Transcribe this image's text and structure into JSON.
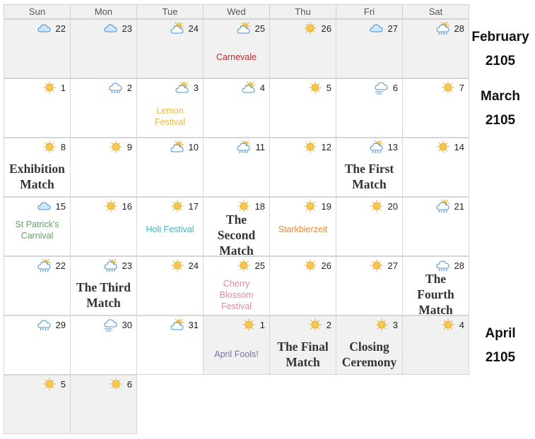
{
  "weekdays": [
    "Sun",
    "Mon",
    "Tue",
    "Wed",
    "Thu",
    "Fri",
    "Sat"
  ],
  "side_labels": [
    {
      "month": "February",
      "year": "2105"
    },
    {
      "month": "March",
      "year": "2105"
    },
    {
      "month": "April",
      "year": "2105"
    }
  ],
  "colors": {
    "header_bg": "#f0f0f0",
    "other_month_bg": "#f1f1f1",
    "sun": "#f5c242",
    "cloud": "#7fb8e6"
  },
  "weeks": [
    [
      {
        "day": "22",
        "weather": "cloud",
        "gray": true
      },
      {
        "day": "23",
        "weather": "cloud",
        "gray": true
      },
      {
        "day": "24",
        "weather": "partly-sunny",
        "gray": true
      },
      {
        "day": "25",
        "weather": "partly-sunny",
        "gray": true,
        "event": "Carnevale",
        "event_color": "#c0282d"
      },
      {
        "day": "26",
        "weather": "sun",
        "gray": true
      },
      {
        "day": "27",
        "weather": "cloud",
        "gray": true
      },
      {
        "day": "28",
        "weather": "rain-sun",
        "gray": true
      }
    ],
    [
      {
        "day": "1",
        "weather": "sun"
      },
      {
        "day": "2",
        "weather": "rain"
      },
      {
        "day": "3",
        "weather": "partly-sunny",
        "event": "Lemon Festival",
        "event_color": "#e8b84a"
      },
      {
        "day": "4",
        "weather": "partly-sunny"
      },
      {
        "day": "5",
        "weather": "sun"
      },
      {
        "day": "6",
        "weather": "windy-cloud"
      },
      {
        "day": "7",
        "weather": "sun"
      }
    ],
    [
      {
        "day": "8",
        "weather": "sun",
        "big": "Exhibition Match"
      },
      {
        "day": "9",
        "weather": "sun"
      },
      {
        "day": "10",
        "weather": "partly-sunny"
      },
      {
        "day": "11",
        "weather": "rain-sun"
      },
      {
        "day": "12",
        "weather": "sun"
      },
      {
        "day": "13",
        "weather": "rain-sun",
        "big": "The First Match"
      },
      {
        "day": "14",
        "weather": "sun"
      }
    ],
    [
      {
        "day": "15",
        "weather": "cloud",
        "event": "St Patrick's Carnival",
        "event_color": "#5aa85a"
      },
      {
        "day": "16",
        "weather": "sun"
      },
      {
        "day": "17",
        "weather": "sun",
        "event": "Holi Festival",
        "event_color": "#3fb5c3"
      },
      {
        "day": "18",
        "weather": "sun",
        "big": "The Second Match"
      },
      {
        "day": "19",
        "weather": "sun",
        "event": "Starkbierzeit",
        "event_color": "#e08a3c"
      },
      {
        "day": "20",
        "weather": "sun"
      },
      {
        "day": "21",
        "weather": "rain-sun"
      }
    ],
    [
      {
        "day": "22",
        "weather": "rain-sun"
      },
      {
        "day": "23",
        "weather": "rain-sun",
        "big": "The Third Match"
      },
      {
        "day": "24",
        "weather": "sun"
      },
      {
        "day": "25",
        "weather": "sun",
        "event": "Cherry Blossom Festival",
        "event_color": "#e28a98"
      },
      {
        "day": "26",
        "weather": "sun"
      },
      {
        "day": "27",
        "weather": "sun"
      },
      {
        "day": "28",
        "weather": "rain",
        "big": "The Fourth Match"
      }
    ],
    [
      {
        "day": "29",
        "weather": "rain"
      },
      {
        "day": "30",
        "weather": "windy-cloud"
      },
      {
        "day": "31",
        "weather": "partly-sunny"
      },
      {
        "day": "1",
        "weather": "sun",
        "gray": true,
        "event": "April Fools!",
        "event_color": "#7a6fb0"
      },
      {
        "day": "2",
        "weather": "sun",
        "gray": true,
        "big": "The Final Match"
      },
      {
        "day": "3",
        "weather": "sun",
        "gray": true,
        "big": "Closing Ceremony"
      },
      {
        "day": "4",
        "weather": "sun",
        "gray": true
      }
    ],
    [
      {
        "day": "5",
        "weather": "sun",
        "gray": true
      },
      {
        "day": "6",
        "weather": "sun",
        "gray": true
      }
    ]
  ]
}
